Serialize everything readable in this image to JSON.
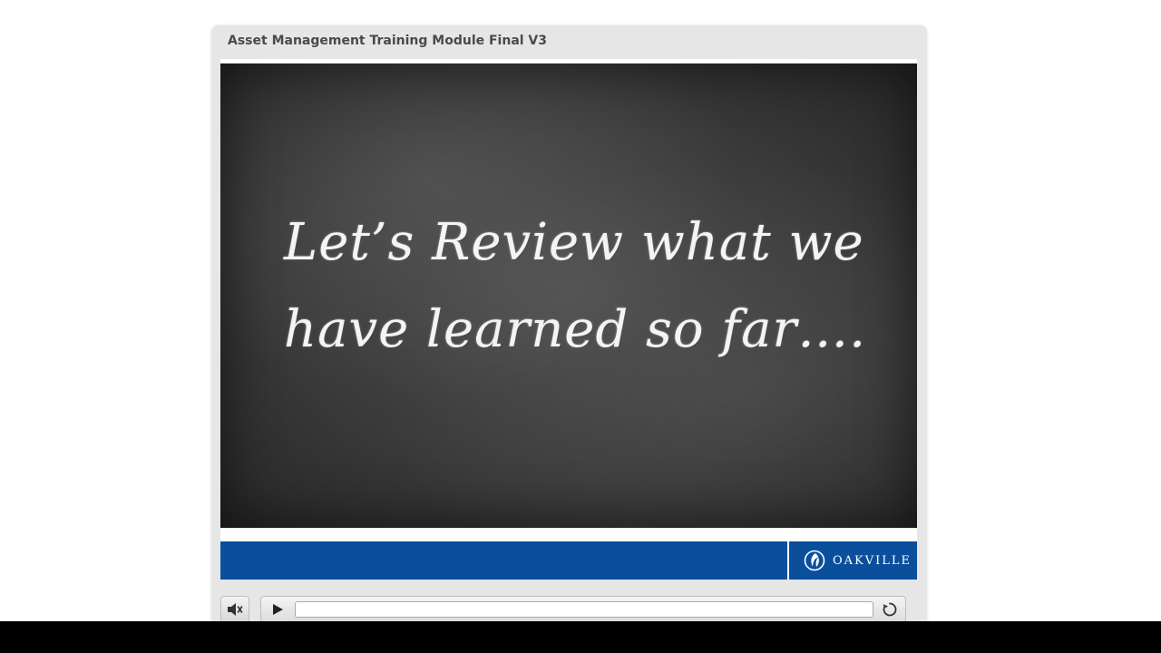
{
  "player": {
    "title": "Asset Management Training Module Final V3"
  },
  "slide": {
    "lines": [
      "Let’s Review what we",
      "have learned so far…."
    ]
  },
  "footer": {
    "brand_color": "#0b4f9c",
    "logo_text": "OAKVILLE"
  },
  "controls": {
    "mute_icon": "speaker-icon",
    "play_icon": "play-icon",
    "replay_icon": "replay-icon",
    "progress": 0
  }
}
